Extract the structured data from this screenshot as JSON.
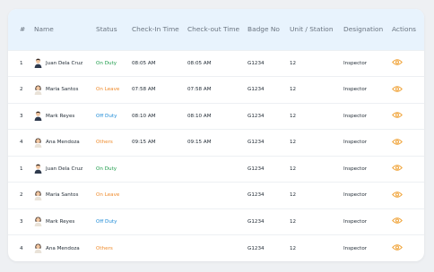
{
  "table": {
    "headers": [
      "#",
      "Name",
      "Status",
      "Check-In Time",
      "Check-out Time",
      "Badge No",
      "Unit / Station",
      "Designation",
      "Actions"
    ],
    "rows": [
      {
        "num": "1",
        "name": "Juan Dela Cruz",
        "status": "On Duty",
        "status_color": "green",
        "checkin": "08:05 AM",
        "checkout": "08:05 AM",
        "badge": "G1234",
        "unit": "12",
        "designation": "Inspector",
        "avatar": "male-avatar-icon"
      },
      {
        "num": "2",
        "name": "Maria Santos",
        "status": "On Leave",
        "status_color": "orange",
        "checkin": "07:58 AM",
        "checkout": "07:58 AM",
        "badge": "G1234",
        "unit": "12",
        "designation": "Inspector",
        "avatar": "female-avatar-icon"
      },
      {
        "num": "3",
        "name": "Mark Reyes",
        "status": "Off Duty",
        "status_color": "blue",
        "checkin": "08:10 AM",
        "checkout": "08:10 AM",
        "badge": "G1234",
        "unit": "12",
        "designation": "Inspector",
        "avatar": "male-avatar-icon"
      },
      {
        "num": "4",
        "name": "Ana Mendoza",
        "status": "Others",
        "status_color": "orange",
        "checkin": "09:15 AM",
        "checkout": "09:15 AM",
        "badge": "G1234",
        "unit": "12",
        "designation": "Inspector",
        "avatar": "female-avatar-icon"
      },
      {
        "num": "1",
        "name": "Juan Dela Cruz",
        "status": "On Duty",
        "status_color": "green",
        "checkin": "",
        "checkout": "",
        "badge": "G1234",
        "unit": "12",
        "designation": "Inspector",
        "avatar": "male-avatar-icon"
      },
      {
        "num": "2",
        "name": "Maria Santos",
        "status": "On Leave",
        "status_color": "orange",
        "checkin": "",
        "checkout": "",
        "badge": "G1234",
        "unit": "12",
        "designation": "Inspector",
        "avatar": "female-avatar-icon"
      },
      {
        "num": "3",
        "name": "Mark Reyes",
        "status": "Off Duty",
        "status_color": "blue",
        "checkin": "",
        "checkout": "",
        "badge": "G1234",
        "unit": "12",
        "designation": "Inspector",
        "avatar": "female-avatar-icon"
      },
      {
        "num": "4",
        "name": "Ana Mendoza",
        "status": "Others",
        "status_color": "orange",
        "checkin": "",
        "checkout": "",
        "badge": "G1234",
        "unit": "12",
        "designation": "Inspector",
        "avatar": "female-avatar-icon"
      }
    ]
  },
  "colors": {
    "header_bg": "#e8f3fd",
    "green": "#1e9c4b",
    "orange": "#ef8b2c",
    "blue": "#1c8ad6",
    "eye": "#f0a43a"
  }
}
